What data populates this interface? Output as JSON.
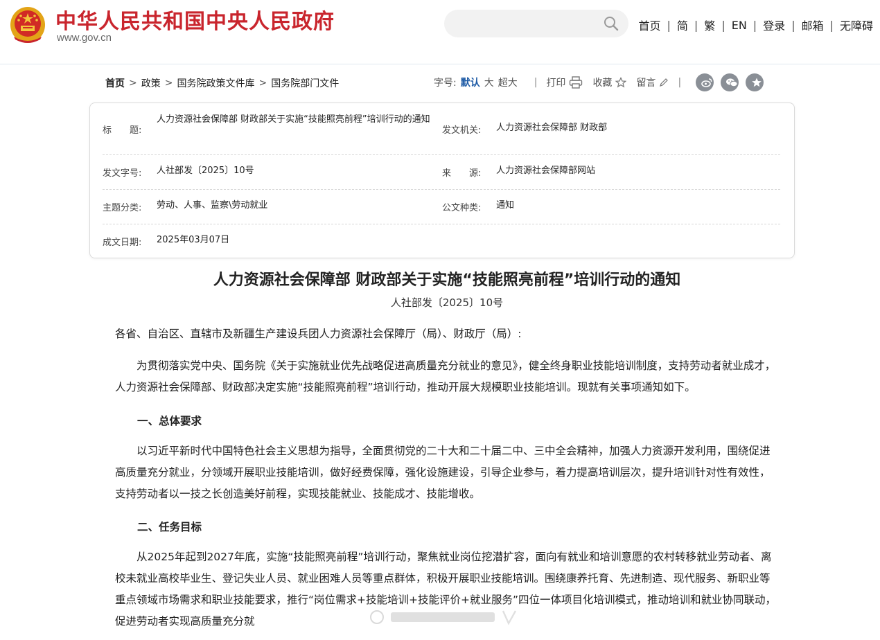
{
  "header": {
    "site_title": "中华人民共和国中央人民政府",
    "site_url": "www.gov.cn",
    "search_placeholder": "",
    "nav": [
      "首页",
      "简",
      "繁",
      "EN",
      "登录",
      "邮箱",
      "无障碍"
    ],
    "nav_separator": "|",
    "brand_color": "#c9252d"
  },
  "breadcrumb": {
    "items": [
      "首页",
      "政策",
      "国务院政策文件库",
      "国务院部门文件"
    ],
    "separator": ">"
  },
  "toolbar": {
    "font_size_label": "字号:",
    "font_sizes": [
      "默认",
      "大",
      "超大"
    ],
    "active_font_size": "默认",
    "divider": "|",
    "print_label": "打印",
    "favorite_label": "收藏",
    "comment_label": "留言",
    "share_icons": [
      "weibo-icon",
      "wechat-icon",
      "star-share-icon"
    ],
    "accent_color": "#1d5aa5"
  },
  "info": {
    "title_label": "标　　题:",
    "title_value": "人力资源社会保障部 财政部关于实施“技能照亮前程”培训行动的通知",
    "issuer_label": "发文机关:",
    "issuer_value": "人力资源社会保障部 财政部",
    "docno_label": "发文字号:",
    "docno_value": "人社部发〔2025〕10号",
    "source_label": "来　　源:",
    "source_value": "人力资源社会保障部网站",
    "topic_label": "主题分类:",
    "topic_value": "劳动、人事、监察\\劳动就业",
    "type_label": "公文种类:",
    "type_value": "通知",
    "date_label": "成文日期:",
    "date_value": "2025年03月07日"
  },
  "article": {
    "title": "人力资源社会保障部 财政部关于实施“技能照亮前程”培训行动的通知",
    "doc_number": "人社部发〔2025〕10号",
    "salutation": "各省、自治区、直辖市及新疆生产建设兵团人力资源社会保障厅（局）、财政厅（局）:",
    "intro": "为贯彻落实党中央、国务院《关于实施就业优先战略促进高质量充分就业的意见》，健全终身职业技能培训制度，支持劳动者就业成才，人力资源社会保障部、财政部决定实施“技能照亮前程”培训行动，推动开展大规模职业技能培训。现就有关事项通知如下。",
    "section1_heading": "一、总体要求",
    "section1_text": "以习近平新时代中国特色社会主义思想为指导，全面贯彻党的二十大和二十届二中、三中全会精神，加强人力资源开发利用，围绕促进高质量充分就业，分领域开展职业技能培训，做好经费保障，强化设施建设，引导企业参与，着力提高培训层次，提升培训针对性有效性，支持劳动者以一技之长创造美好前程，实现技能就业、技能成才、技能增收。",
    "section2_heading": "二、任务目标",
    "section2_text": "从2025年起到2027年底，实施“技能照亮前程”培训行动，聚焦就业岗位挖潜扩容，面向有就业和培训意愿的农村转移就业劳动者、离校未就业高校毕业生、登记失业人员、就业困难人员等重点群体，积极开展职业技能培训。围绕康养托育、先进制造、现代服务、新职业等重点领域市场需求和职业技能要求，推行“岗位需求+技能培训+技能评价+就业服务”四位一体项目化培训模式，推动培训和就业协同联动，促进劳动者实现高质量充分就"
  }
}
